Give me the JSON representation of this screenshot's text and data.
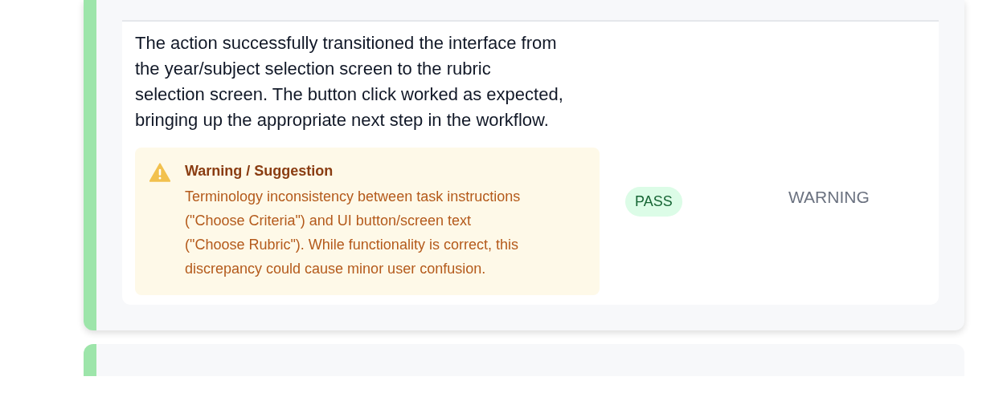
{
  "cards": [
    {
      "color": "#9de5aa",
      "rows": [
        {
          "description": "The action successfully transitioned the interface from the year/subject selection screen to the rubric selection screen. The button click worked as expected, bringing up the appropriate next step in the workflow.",
          "warning": {
            "title": "Warning / Suggestion",
            "text": "Terminology inconsistency between task instructions (\"Choose Criteria\") and UI button/screen text (\"Choose Rubric\"). While functionality is correct, this discrepancy could cause minor user confusion."
          },
          "result": "PASS",
          "status": "WARNING"
        }
      ]
    },
    {
      "color": "#9de5aa"
    }
  ]
}
